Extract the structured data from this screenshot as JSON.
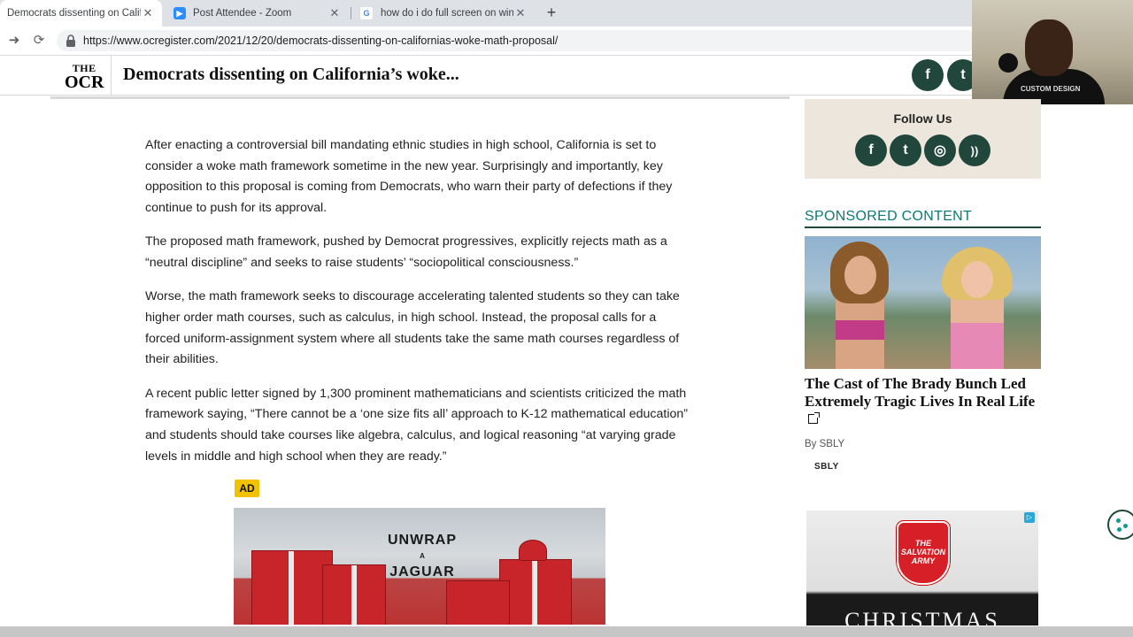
{
  "browser": {
    "tabs": [
      {
        "title": "Democrats dissenting on Califor",
        "close": "✕",
        "favicon_color": "#00563f",
        "active": true
      },
      {
        "title": "Post Attendee - Zoom",
        "close": "✕",
        "favicon_color": "#2d8cff",
        "active": false
      },
      {
        "title": "how do i do full screen on windo",
        "close": "✕",
        "favicon_color": "#4285f4",
        "active": false
      }
    ],
    "new_tab": "+",
    "url": "https://www.ocregister.com/2021/12/20/democrats-dissenting-on-californias-woke-math-proposal/"
  },
  "site": {
    "logo_line1": "THE",
    "logo_line2": "OCR",
    "headline": "Democrats dissenting on California’s woke...",
    "header_social": [
      "f",
      "t"
    ]
  },
  "article": {
    "paragraphs": [
      "After enacting a controversial bill mandating ethnic studies in high school, California is set to consider a woke math framework sometime in the new year.  Surprisingly and importantly, key opposition to this proposal is coming from Democrats, who warn their party of defections if they continue to push for its approval.",
      "The proposed math framework, pushed by Democrat progressives, explicitly rejects math as a “neutral discipline” and seeks to raise students’ “sociopolitical consciousness.”",
      "Worse, the math framework seeks to discourage accelerating talented students so they can take higher order math courses, such as calculus, in high school.  Instead, the proposal calls for a forced uniform-assignment system where all students take the same math courses regardless of their abilities.",
      "A recent public letter signed by 1,300 prominent mathematicians and scientists criticized the math framework saying, “There cannot be a ‘one size fits all’ approach to K-12 mathematical education” and students should take courses like algebra, calculus, and logical reasoning “at varying grade levels in middle and high school when they are ready.”"
    ],
    "ad_badge": "AD",
    "ad_line1": "UNWRAP",
    "ad_line2": "A",
    "ad_line3": "JAGUAR"
  },
  "sidebar": {
    "follow_title": "Follow Us",
    "follow_icons": [
      "f",
      "t",
      "◎",
      "))"
    ],
    "sponsored_heading": "SPONSORED CONTENT",
    "sponsored_title": "The Cast of The Brady Bunch Led Extremely Tragic Lives In Real Life",
    "byline": "By SBLY",
    "sponsor_logo": "SBLY",
    "ad2_shield": "THE SALVATION ARMY",
    "ad2_bottom": "CHRISTMAS"
  },
  "webcam": {
    "shirt_text": "CUSTOM DESIGN"
  },
  "colors": {
    "brand_green": "#21463c",
    "sponsored_teal": "#0b7a75",
    "ad_yellow": "#f2c200"
  }
}
